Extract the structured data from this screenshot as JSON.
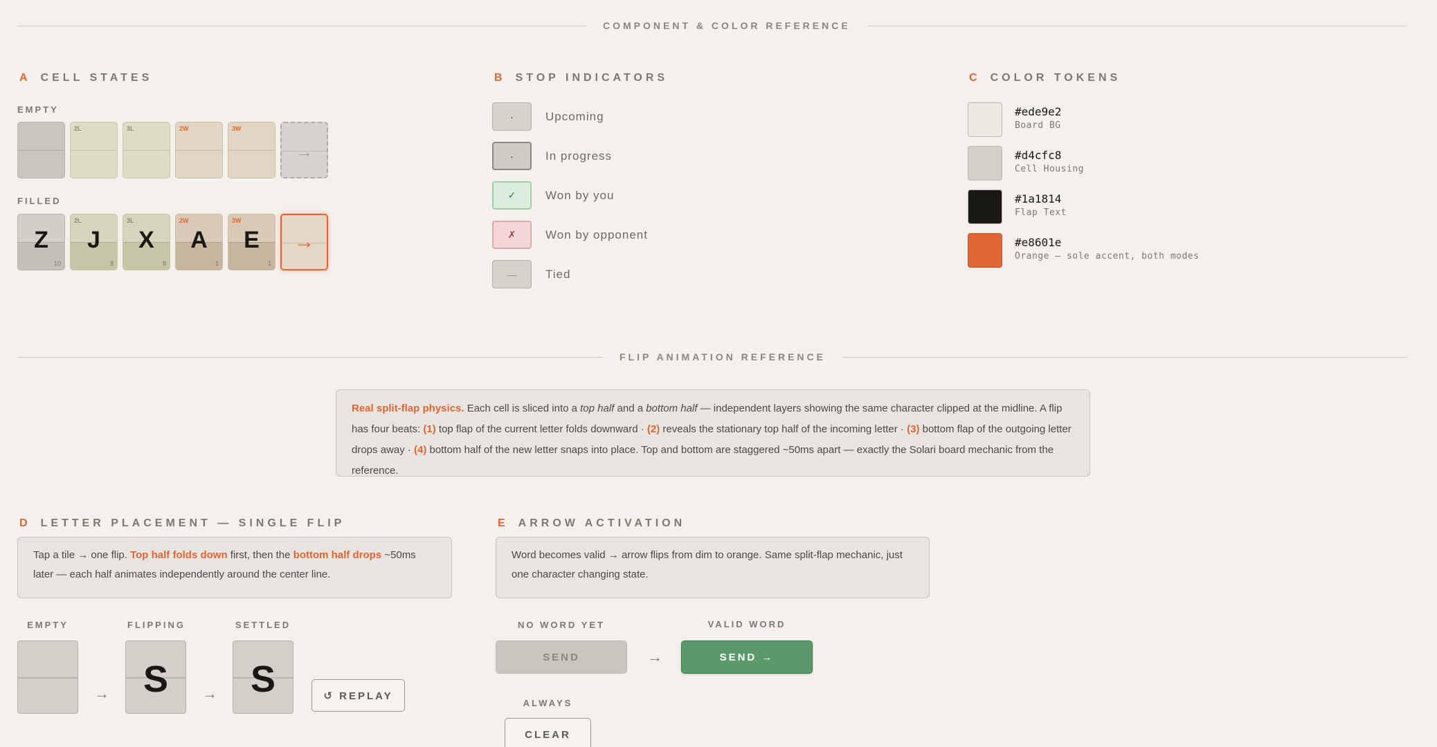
{
  "dividers": {
    "component_color": "COMPONENT & COLOR REFERENCE",
    "flip_animation": "FLIP ANIMATION REFERENCE"
  },
  "sections": {
    "a": {
      "letter": "A",
      "title": "CELL STATES"
    },
    "b": {
      "letter": "B",
      "title": "STOP INDICATORS"
    },
    "c": {
      "letter": "C",
      "title": "COLOR TOKENS"
    },
    "d": {
      "letter": "D",
      "title": "LETTER PLACEMENT — SINGLE FLIP"
    },
    "e": {
      "letter": "E",
      "title": "ARROW ACTIVATION"
    }
  },
  "cell_states": {
    "empty_label": "EMPTY",
    "filled_label": "FILLED",
    "empty_cells": [
      {
        "mult": ""
      },
      {
        "mult": "2L"
      },
      {
        "mult": "3L"
      },
      {
        "mult": "2W"
      },
      {
        "mult": "3W"
      }
    ],
    "filled_cells": [
      {
        "mult": "",
        "char": "Z",
        "pts": "10"
      },
      {
        "mult": "2L",
        "char": "J",
        "pts": "8"
      },
      {
        "mult": "3L",
        "char": "X",
        "pts": "8"
      },
      {
        "mult": "2W",
        "char": "A",
        "pts": "1"
      },
      {
        "mult": "3W",
        "char": "E",
        "pts": "1"
      }
    ],
    "arrow_glyph": "→"
  },
  "stop_indicators": [
    {
      "symbol": "·",
      "label": "Upcoming"
    },
    {
      "symbol": "·",
      "label": "In progress"
    },
    {
      "symbol": "✓",
      "label": "Won by you"
    },
    {
      "symbol": "✗",
      "label": "Won by opponent"
    },
    {
      "symbol": "—",
      "label": "Tied"
    }
  ],
  "color_tokens": [
    {
      "hex": "#ede9e2",
      "desc": "Board BG",
      "color": "#ede9e2"
    },
    {
      "hex": "#d4cfc8",
      "desc": "Cell Housing",
      "color": "#d4cfc8"
    },
    {
      "hex": "#1a1814",
      "desc": "Flap Text",
      "color": "#1a1814"
    },
    {
      "hex": "#e8601e",
      "desc": "Orange — sole accent, both modes",
      "color": "#e06535"
    }
  ],
  "flip_info": {
    "lead": "Real split-flap physics.",
    "t1": " Each cell is sliced into a ",
    "top_half": "top half",
    "t2": " and a ",
    "bottom_half": "bottom half",
    "t3": " — independent layers showing the same character clipped at the midline. A flip has four beats: ",
    "n1": "(1)",
    "t4": " top flap of the current letter folds downward · ",
    "n2": "(2)",
    "t5": " reveals the stationary top half of the incoming letter · ",
    "n3": "(3)",
    "t6": " bottom flap of the outgoing letter drops away · ",
    "n4": "(4)",
    "t7": " bottom half of the new letter snaps into place. Top and bottom are staggered ~50ms apart — exactly the Solari board mechanic from the reference."
  },
  "letter_placement": {
    "t1": "Tap a tile → one flip. ",
    "top": "Top half folds down",
    "t2": " first, then the ",
    "bottom": "bottom half drops",
    "t3": " ~50ms later — each half animates independently around the center line.",
    "labels": [
      "EMPTY",
      "FLIPPING",
      "SETTLED"
    ],
    "flipping_char": "S",
    "settled_char": "S",
    "flow_arrow": "→",
    "replay": "↺ REPLAY"
  },
  "arrow_activation": {
    "text": "Word becomes valid → arrow flips from dim to orange. Same split-flap mechanic, just one character changing state.",
    "no_word_label": "NO WORD YET",
    "valid_label": "VALID WORD",
    "send_dim": "SEND",
    "send_active": "SEND →",
    "flow_arrow": "→",
    "always_label": "ALWAYS",
    "clear": "CLEAR"
  }
}
